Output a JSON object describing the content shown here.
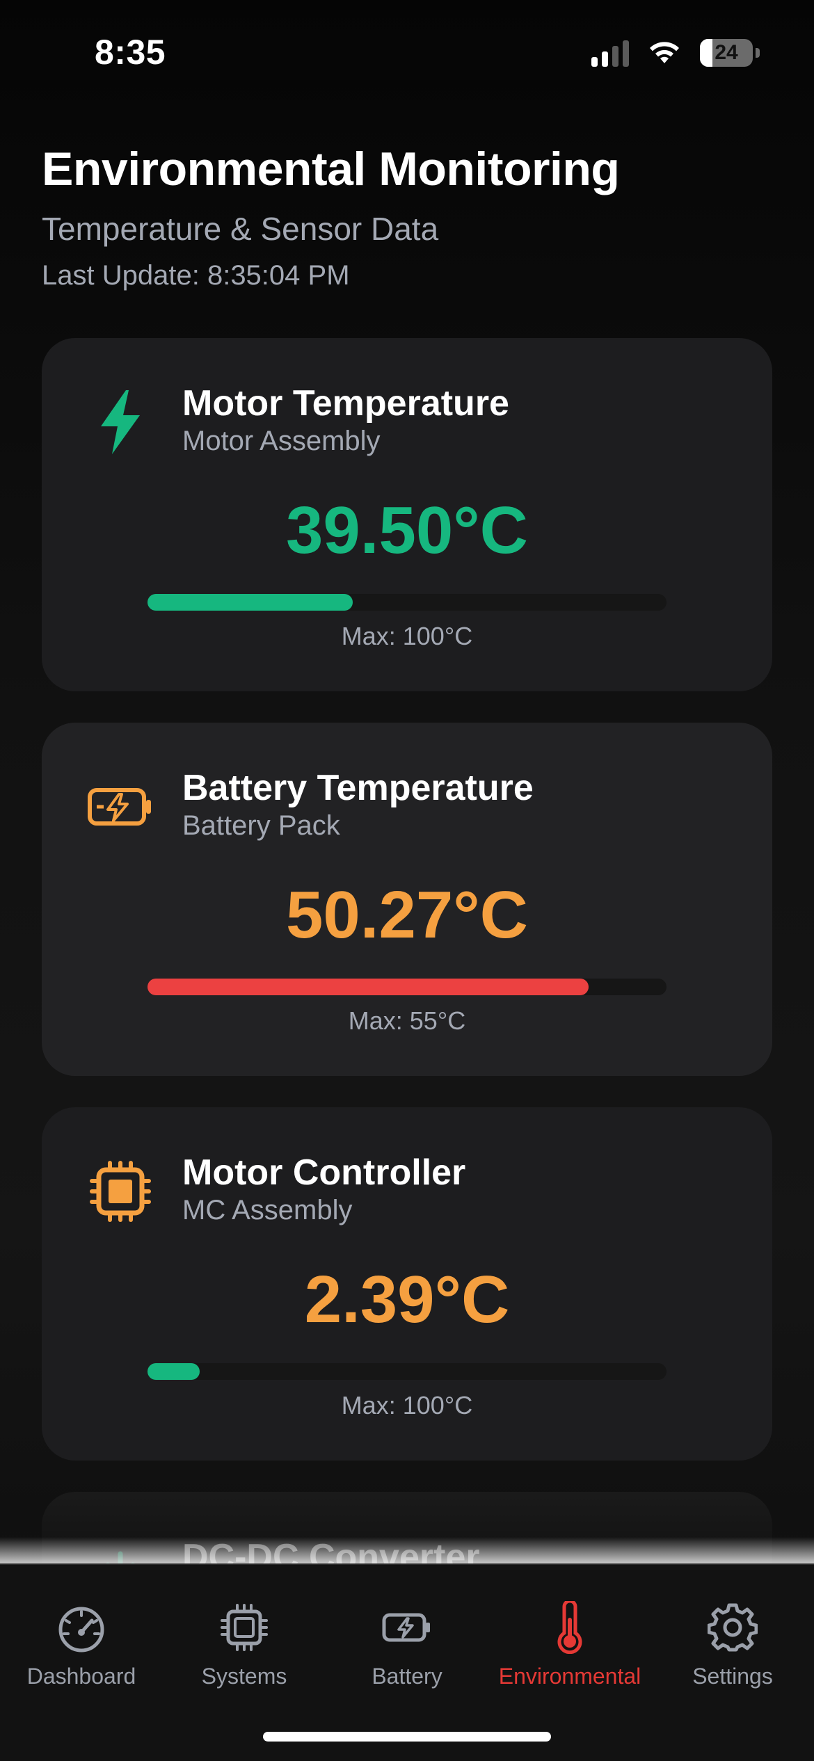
{
  "status_bar": {
    "time": "8:35",
    "battery_level": "24"
  },
  "header": {
    "title": "Environmental Monitoring",
    "subtitle": "Temperature & Sensor Data",
    "last_update_label": "Last Update:",
    "last_update_time": "8:35:04 PM"
  },
  "cards": [
    {
      "title": "Motor Temperature",
      "subtitle": "Motor Assembly",
      "value": "39.50°C",
      "max": "Max: 100°C",
      "fill_fraction": 0.395,
      "value_color": "#16b77f",
      "bar_color": "#16b77f",
      "icon": "lightning-bolt-icon"
    },
    {
      "title": "Battery Temperature",
      "subtitle": "Battery Pack",
      "value": "50.27°C",
      "max": "Max: 55°C",
      "fill_fraction": 0.85,
      "value_color": "#f5a040",
      "bar_color": "#ec4141",
      "icon": "battery-charging-icon"
    },
    {
      "title": "Motor Controller",
      "subtitle": "MC Assembly",
      "value": "2.39°C",
      "max": "Max: 100°C",
      "fill_fraction": 0.1,
      "value_color": "#f5a040",
      "bar_color": "#16b77f",
      "icon": "cpu-chip-icon"
    },
    {
      "title": "DC-DC Converter",
      "icon": "power-icon"
    }
  ],
  "tabs": [
    {
      "label": "Dashboard",
      "icon": "speedometer-icon",
      "active": false
    },
    {
      "label": "Systems",
      "icon": "cpu-chip-icon",
      "active": false
    },
    {
      "label": "Battery",
      "icon": "battery-charging-icon",
      "active": false
    },
    {
      "label": "Environmental",
      "icon": "thermometer-icon",
      "active": true
    },
    {
      "label": "Settings",
      "icon": "gear-icon",
      "active": false
    }
  ],
  "colors": {
    "accent_active": "#e53935",
    "green": "#16b77f",
    "orange": "#f5a040",
    "red": "#ec4141",
    "muted_text": "#a4a9b4"
  }
}
